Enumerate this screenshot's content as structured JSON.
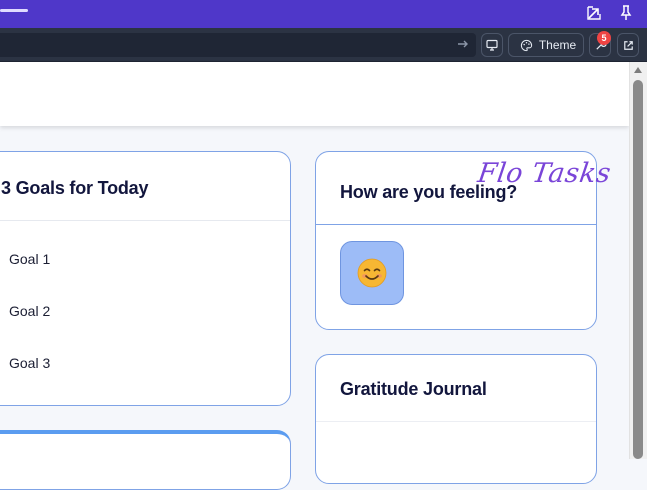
{
  "toolbar": {
    "theme_label": "Theme",
    "notification_count": "5"
  },
  "goals_card": {
    "title": "3 Goals for Today",
    "items": [
      "Goal 1",
      "Goal 2",
      "Goal 3"
    ]
  },
  "feeling_card": {
    "title": "How are you feeling?",
    "selected_mood_icon": "smiling-face-icon"
  },
  "gratitude_card": {
    "title": "Gratitude Journal"
  },
  "brand": {
    "watermark": "Flo Tasks"
  },
  "colors": {
    "titlebar": "#4f37c9",
    "toolbar": "#2b3343",
    "card_border": "#7fa3e6",
    "mood_button": "#9dbcf7",
    "watermark": "#7a45d8",
    "badge": "#ef4444"
  }
}
